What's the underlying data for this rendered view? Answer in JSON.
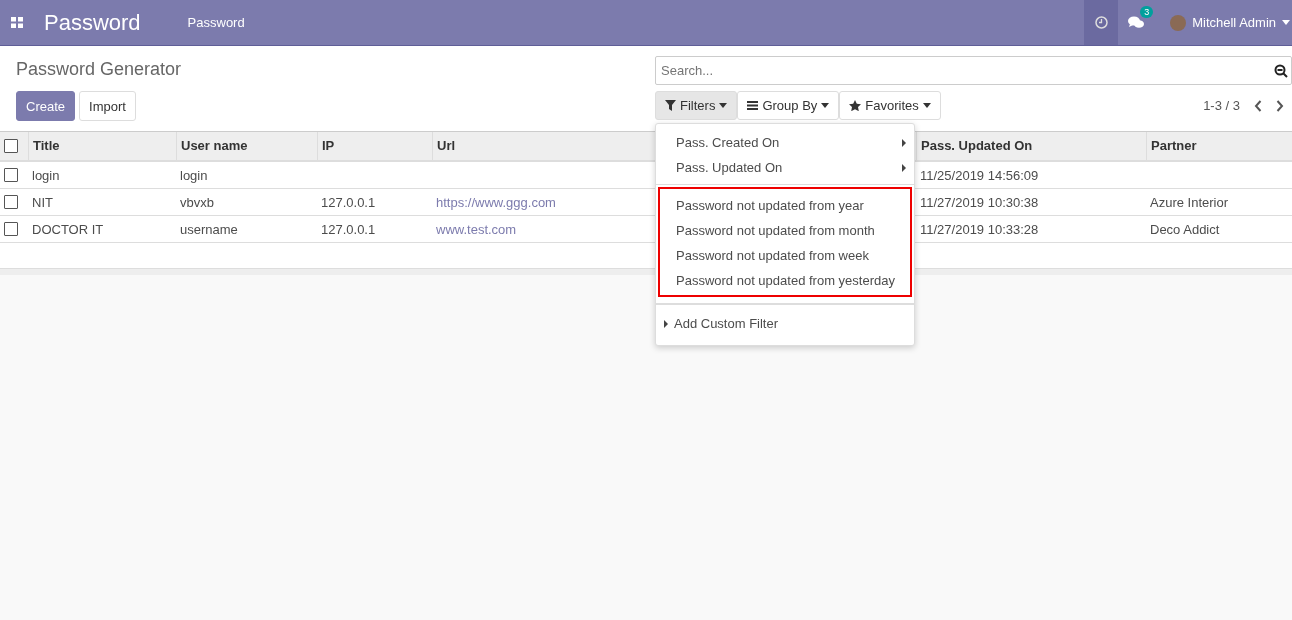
{
  "navbar": {
    "app_title": "Password",
    "menu": [
      {
        "label": "Password"
      }
    ],
    "messages_count": "3",
    "user": "Mitchell Admin"
  },
  "control_panel": {
    "title": "Password Generator",
    "buttons": [
      {
        "label": "Create",
        "kind": "primary"
      },
      {
        "label": "Import",
        "kind": "secondary"
      }
    ],
    "search": {
      "placeholder": "Search..."
    },
    "search_options": [
      {
        "label": "Filters",
        "kind": "filter",
        "selected": true
      },
      {
        "label": "Group By",
        "kind": "group",
        "selected": false
      },
      {
        "label": "Favorites",
        "kind": "star",
        "selected": false
      }
    ],
    "pager": "1-3 / 3"
  },
  "table": {
    "select_all_checked": false,
    "columns": [
      "Title",
      "User name",
      "IP",
      "Url",
      "Pass. Updated On",
      "Partner"
    ],
    "rows": [
      {
        "cells": [
          "login",
          "login",
          "",
          "",
          "11/25/2019 14:56:09",
          ""
        ],
        "checked": false
      },
      {
        "cells": [
          "NIT",
          "vbvxb",
          "127.0.0.1",
          "https://www.ggg.com",
          "11/27/2019 10:30:38",
          "Azure Interior"
        ],
        "checked": false
      },
      {
        "cells": [
          "DOCTOR IT",
          "username",
          "127.0.0.1",
          "www.test.com",
          "11/27/2019 10:33:28",
          "Deco Addict"
        ],
        "checked": false
      }
    ]
  },
  "filters_menu": {
    "sections": [
      {
        "highlighted": false,
        "items": [
          {
            "label": "Pass. Created On",
            "kind": "submenu"
          },
          {
            "label": "Pass. Updated On",
            "kind": "submenu"
          }
        ]
      },
      {
        "highlighted": true,
        "items": [
          {
            "label": "Password not updated from year",
            "kind": "filter"
          },
          {
            "label": "Password not updated from month",
            "kind": "filter"
          },
          {
            "label": "Password not updated from week",
            "kind": "filter"
          },
          {
            "label": "Password not updated from yesterday",
            "kind": "filter"
          }
        ]
      },
      {
        "highlighted": false,
        "items": [
          {
            "label": "Add Custom Filter",
            "kind": "custom"
          }
        ]
      }
    ]
  }
}
